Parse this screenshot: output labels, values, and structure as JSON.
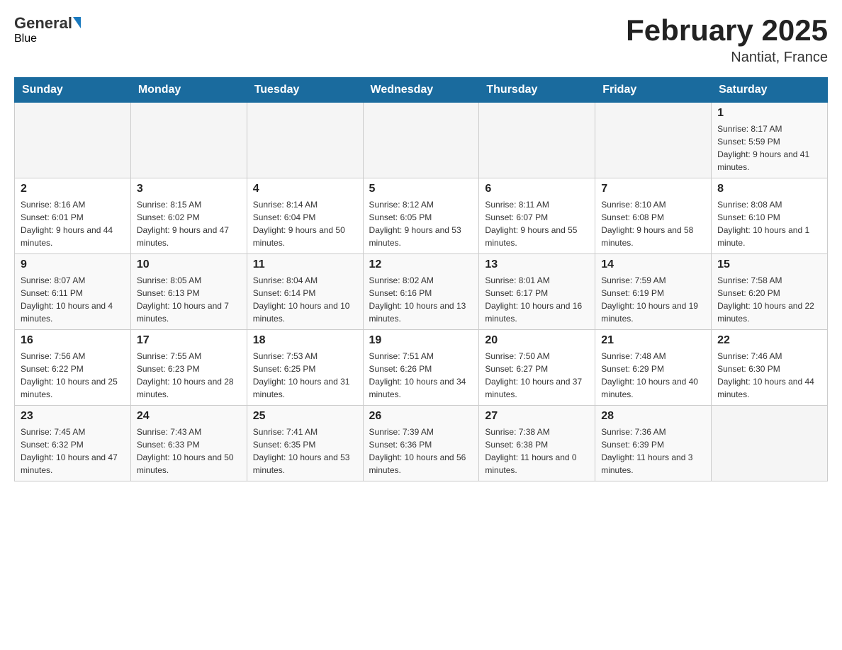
{
  "header": {
    "logo_general": "General",
    "logo_blue": "Blue",
    "month_title": "February 2025",
    "location": "Nantiat, France"
  },
  "days_of_week": [
    "Sunday",
    "Monday",
    "Tuesday",
    "Wednesday",
    "Thursday",
    "Friday",
    "Saturday"
  ],
  "weeks": [
    [
      {
        "day": "",
        "info": ""
      },
      {
        "day": "",
        "info": ""
      },
      {
        "day": "",
        "info": ""
      },
      {
        "day": "",
        "info": ""
      },
      {
        "day": "",
        "info": ""
      },
      {
        "day": "",
        "info": ""
      },
      {
        "day": "1",
        "info": "Sunrise: 8:17 AM\nSunset: 5:59 PM\nDaylight: 9 hours and 41 minutes."
      }
    ],
    [
      {
        "day": "2",
        "info": "Sunrise: 8:16 AM\nSunset: 6:01 PM\nDaylight: 9 hours and 44 minutes."
      },
      {
        "day": "3",
        "info": "Sunrise: 8:15 AM\nSunset: 6:02 PM\nDaylight: 9 hours and 47 minutes."
      },
      {
        "day": "4",
        "info": "Sunrise: 8:14 AM\nSunset: 6:04 PM\nDaylight: 9 hours and 50 minutes."
      },
      {
        "day": "5",
        "info": "Sunrise: 8:12 AM\nSunset: 6:05 PM\nDaylight: 9 hours and 53 minutes."
      },
      {
        "day": "6",
        "info": "Sunrise: 8:11 AM\nSunset: 6:07 PM\nDaylight: 9 hours and 55 minutes."
      },
      {
        "day": "7",
        "info": "Sunrise: 8:10 AM\nSunset: 6:08 PM\nDaylight: 9 hours and 58 minutes."
      },
      {
        "day": "8",
        "info": "Sunrise: 8:08 AM\nSunset: 6:10 PM\nDaylight: 10 hours and 1 minute."
      }
    ],
    [
      {
        "day": "9",
        "info": "Sunrise: 8:07 AM\nSunset: 6:11 PM\nDaylight: 10 hours and 4 minutes."
      },
      {
        "day": "10",
        "info": "Sunrise: 8:05 AM\nSunset: 6:13 PM\nDaylight: 10 hours and 7 minutes."
      },
      {
        "day": "11",
        "info": "Sunrise: 8:04 AM\nSunset: 6:14 PM\nDaylight: 10 hours and 10 minutes."
      },
      {
        "day": "12",
        "info": "Sunrise: 8:02 AM\nSunset: 6:16 PM\nDaylight: 10 hours and 13 minutes."
      },
      {
        "day": "13",
        "info": "Sunrise: 8:01 AM\nSunset: 6:17 PM\nDaylight: 10 hours and 16 minutes."
      },
      {
        "day": "14",
        "info": "Sunrise: 7:59 AM\nSunset: 6:19 PM\nDaylight: 10 hours and 19 minutes."
      },
      {
        "day": "15",
        "info": "Sunrise: 7:58 AM\nSunset: 6:20 PM\nDaylight: 10 hours and 22 minutes."
      }
    ],
    [
      {
        "day": "16",
        "info": "Sunrise: 7:56 AM\nSunset: 6:22 PM\nDaylight: 10 hours and 25 minutes."
      },
      {
        "day": "17",
        "info": "Sunrise: 7:55 AM\nSunset: 6:23 PM\nDaylight: 10 hours and 28 minutes."
      },
      {
        "day": "18",
        "info": "Sunrise: 7:53 AM\nSunset: 6:25 PM\nDaylight: 10 hours and 31 minutes."
      },
      {
        "day": "19",
        "info": "Sunrise: 7:51 AM\nSunset: 6:26 PM\nDaylight: 10 hours and 34 minutes."
      },
      {
        "day": "20",
        "info": "Sunrise: 7:50 AM\nSunset: 6:27 PM\nDaylight: 10 hours and 37 minutes."
      },
      {
        "day": "21",
        "info": "Sunrise: 7:48 AM\nSunset: 6:29 PM\nDaylight: 10 hours and 40 minutes."
      },
      {
        "day": "22",
        "info": "Sunrise: 7:46 AM\nSunset: 6:30 PM\nDaylight: 10 hours and 44 minutes."
      }
    ],
    [
      {
        "day": "23",
        "info": "Sunrise: 7:45 AM\nSunset: 6:32 PM\nDaylight: 10 hours and 47 minutes."
      },
      {
        "day": "24",
        "info": "Sunrise: 7:43 AM\nSunset: 6:33 PM\nDaylight: 10 hours and 50 minutes."
      },
      {
        "day": "25",
        "info": "Sunrise: 7:41 AM\nSunset: 6:35 PM\nDaylight: 10 hours and 53 minutes."
      },
      {
        "day": "26",
        "info": "Sunrise: 7:39 AM\nSunset: 6:36 PM\nDaylight: 10 hours and 56 minutes."
      },
      {
        "day": "27",
        "info": "Sunrise: 7:38 AM\nSunset: 6:38 PM\nDaylight: 11 hours and 0 minutes."
      },
      {
        "day": "28",
        "info": "Sunrise: 7:36 AM\nSunset: 6:39 PM\nDaylight: 11 hours and 3 minutes."
      },
      {
        "day": "",
        "info": ""
      }
    ]
  ]
}
